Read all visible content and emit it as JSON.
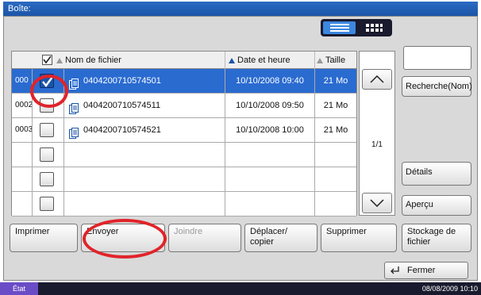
{
  "title": "Boîte:",
  "table": {
    "headers": {
      "name": "Nom de fichier",
      "date": "Date et heure",
      "size": "Taille"
    },
    "rows": [
      {
        "num": "000",
        "checked": true,
        "name": "0404200710574501",
        "date": "10/10/2008 09:40",
        "size": "21  Mo",
        "selected": true
      },
      {
        "num": "0002",
        "checked": false,
        "name": "0404200710574511",
        "date": "10/10/2008 09:50",
        "size": "21  Mo",
        "selected": false
      },
      {
        "num": "0003",
        "checked": false,
        "name": "0404200710574521",
        "date": "10/10/2008 10:00",
        "size": "21  Mo",
        "selected": false
      },
      {
        "num": "",
        "checked": false,
        "name": "",
        "date": "",
        "size": "",
        "selected": false
      },
      {
        "num": "",
        "checked": false,
        "name": "",
        "date": "",
        "size": "",
        "selected": false
      },
      {
        "num": "",
        "checked": false,
        "name": "",
        "date": "",
        "size": "",
        "selected": false
      }
    ]
  },
  "pagination": {
    "page": "1/1"
  },
  "side_buttons": {
    "search": "Recherche(Nom)",
    "details": "Détails",
    "preview": "Aperçu"
  },
  "actions": {
    "print": "Imprimer",
    "send": "Envoyer",
    "join": "Joindre",
    "move_copy": "Déplacer/ copier",
    "delete": "Supprimer",
    "file_storage": "Stockage de fichier"
  },
  "close": "Fermer",
  "status": {
    "label": "État",
    "datetime": "08/08/2009   10:10"
  },
  "colors": {
    "selected_row": "#2a6bd0",
    "highlight": "#e0242a",
    "title_bar": "#1b55a8"
  }
}
